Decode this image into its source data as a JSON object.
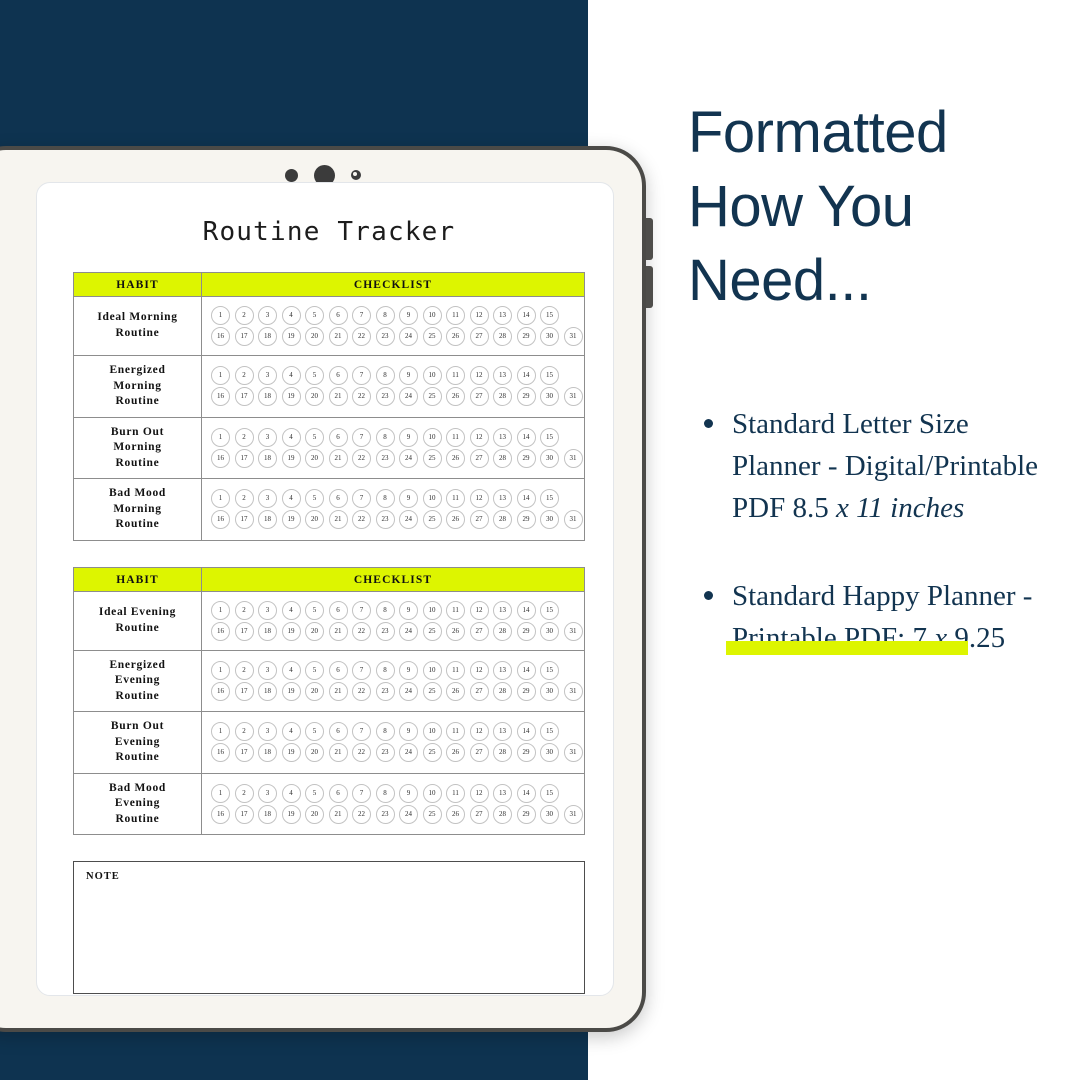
{
  "colors": {
    "navy": "#0E3350",
    "accent_chartreuse": "#DDF500",
    "text_navy": "#123450",
    "tablet_body": "#F7F5F0",
    "tablet_frame": "#4B4A47"
  },
  "marketing": {
    "heading_lines": [
      "Formatted",
      "How You",
      "Need..."
    ],
    "features": [
      {
        "text_plain": "Standard Letter Size Planner - Digital/Printable PDF  8.5 ",
        "text_italic": "x 11 inches"
      },
      {
        "text_plain": "Standard Happy Planner - Printable PDF: 7 ",
        "text_italic": "x",
        "text_tail": " 9.25"
      }
    ]
  },
  "planner": {
    "title": "Routine Tracker",
    "columns": {
      "habit": "HABIT",
      "checklist": "CHECKLIST"
    },
    "day_numbers_row1": [
      "1",
      "2",
      "3",
      "4",
      "5",
      "6",
      "7",
      "8",
      "9",
      "10",
      "11",
      "12",
      "13",
      "14",
      "15"
    ],
    "day_numbers_row2": [
      "16",
      "17",
      "18",
      "19",
      "20",
      "21",
      "22",
      "23",
      "24",
      "25",
      "26",
      "27",
      "28",
      "29",
      "30",
      "31"
    ],
    "tables": [
      {
        "rows": [
          {
            "habit": "Ideal Morning\nRoutine"
          },
          {
            "habit": "Energized\nMorning\nRoutine"
          },
          {
            "habit": "Burn Out\nMorning\nRoutine"
          },
          {
            "habit": "Bad Mood\nMorning\nRoutine"
          }
        ]
      },
      {
        "rows": [
          {
            "habit": "Ideal Evening\nRoutine"
          },
          {
            "habit": "Energized\nEvening\nRoutine"
          },
          {
            "habit": "Burn Out\nEvening\nRoutine"
          },
          {
            "habit": "Bad Mood\nEvening\nRoutine"
          }
        ]
      }
    ],
    "note_label": "NOTE",
    "note_value": ""
  },
  "device": {
    "camera_dots": [
      "camera-lens-small",
      "camera-lens-large",
      "camera-sensor-tiny"
    ],
    "side_buttons": [
      "volume-up",
      "volume-down"
    ]
  }
}
